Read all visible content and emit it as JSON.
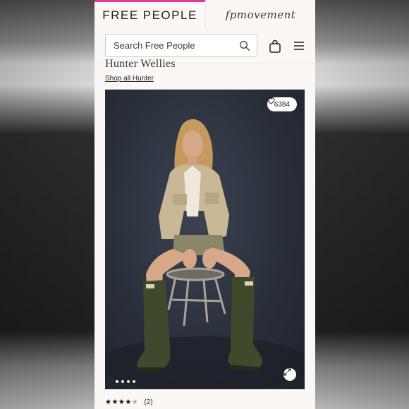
{
  "brand_tabs": {
    "primary": "FREE PEOPLE",
    "secondary": "fpmovement"
  },
  "search": {
    "placeholder": "Search Free People"
  },
  "icons": {
    "search": "search-icon",
    "bag": "shopping-bag-icon",
    "menu": "hamburger-menu-icon",
    "heart": "heart-icon",
    "expand": "expand-icon"
  },
  "colors": {
    "accent": "#e2379e",
    "page_bg": "#faf7f5"
  },
  "product": {
    "heading": "Hunter Wellies",
    "shop_link": "Shop all Hunter",
    "likes": "6384",
    "rating_stars": 4,
    "rating_max": 5,
    "review_count": "(2)",
    "image_count": 4
  }
}
